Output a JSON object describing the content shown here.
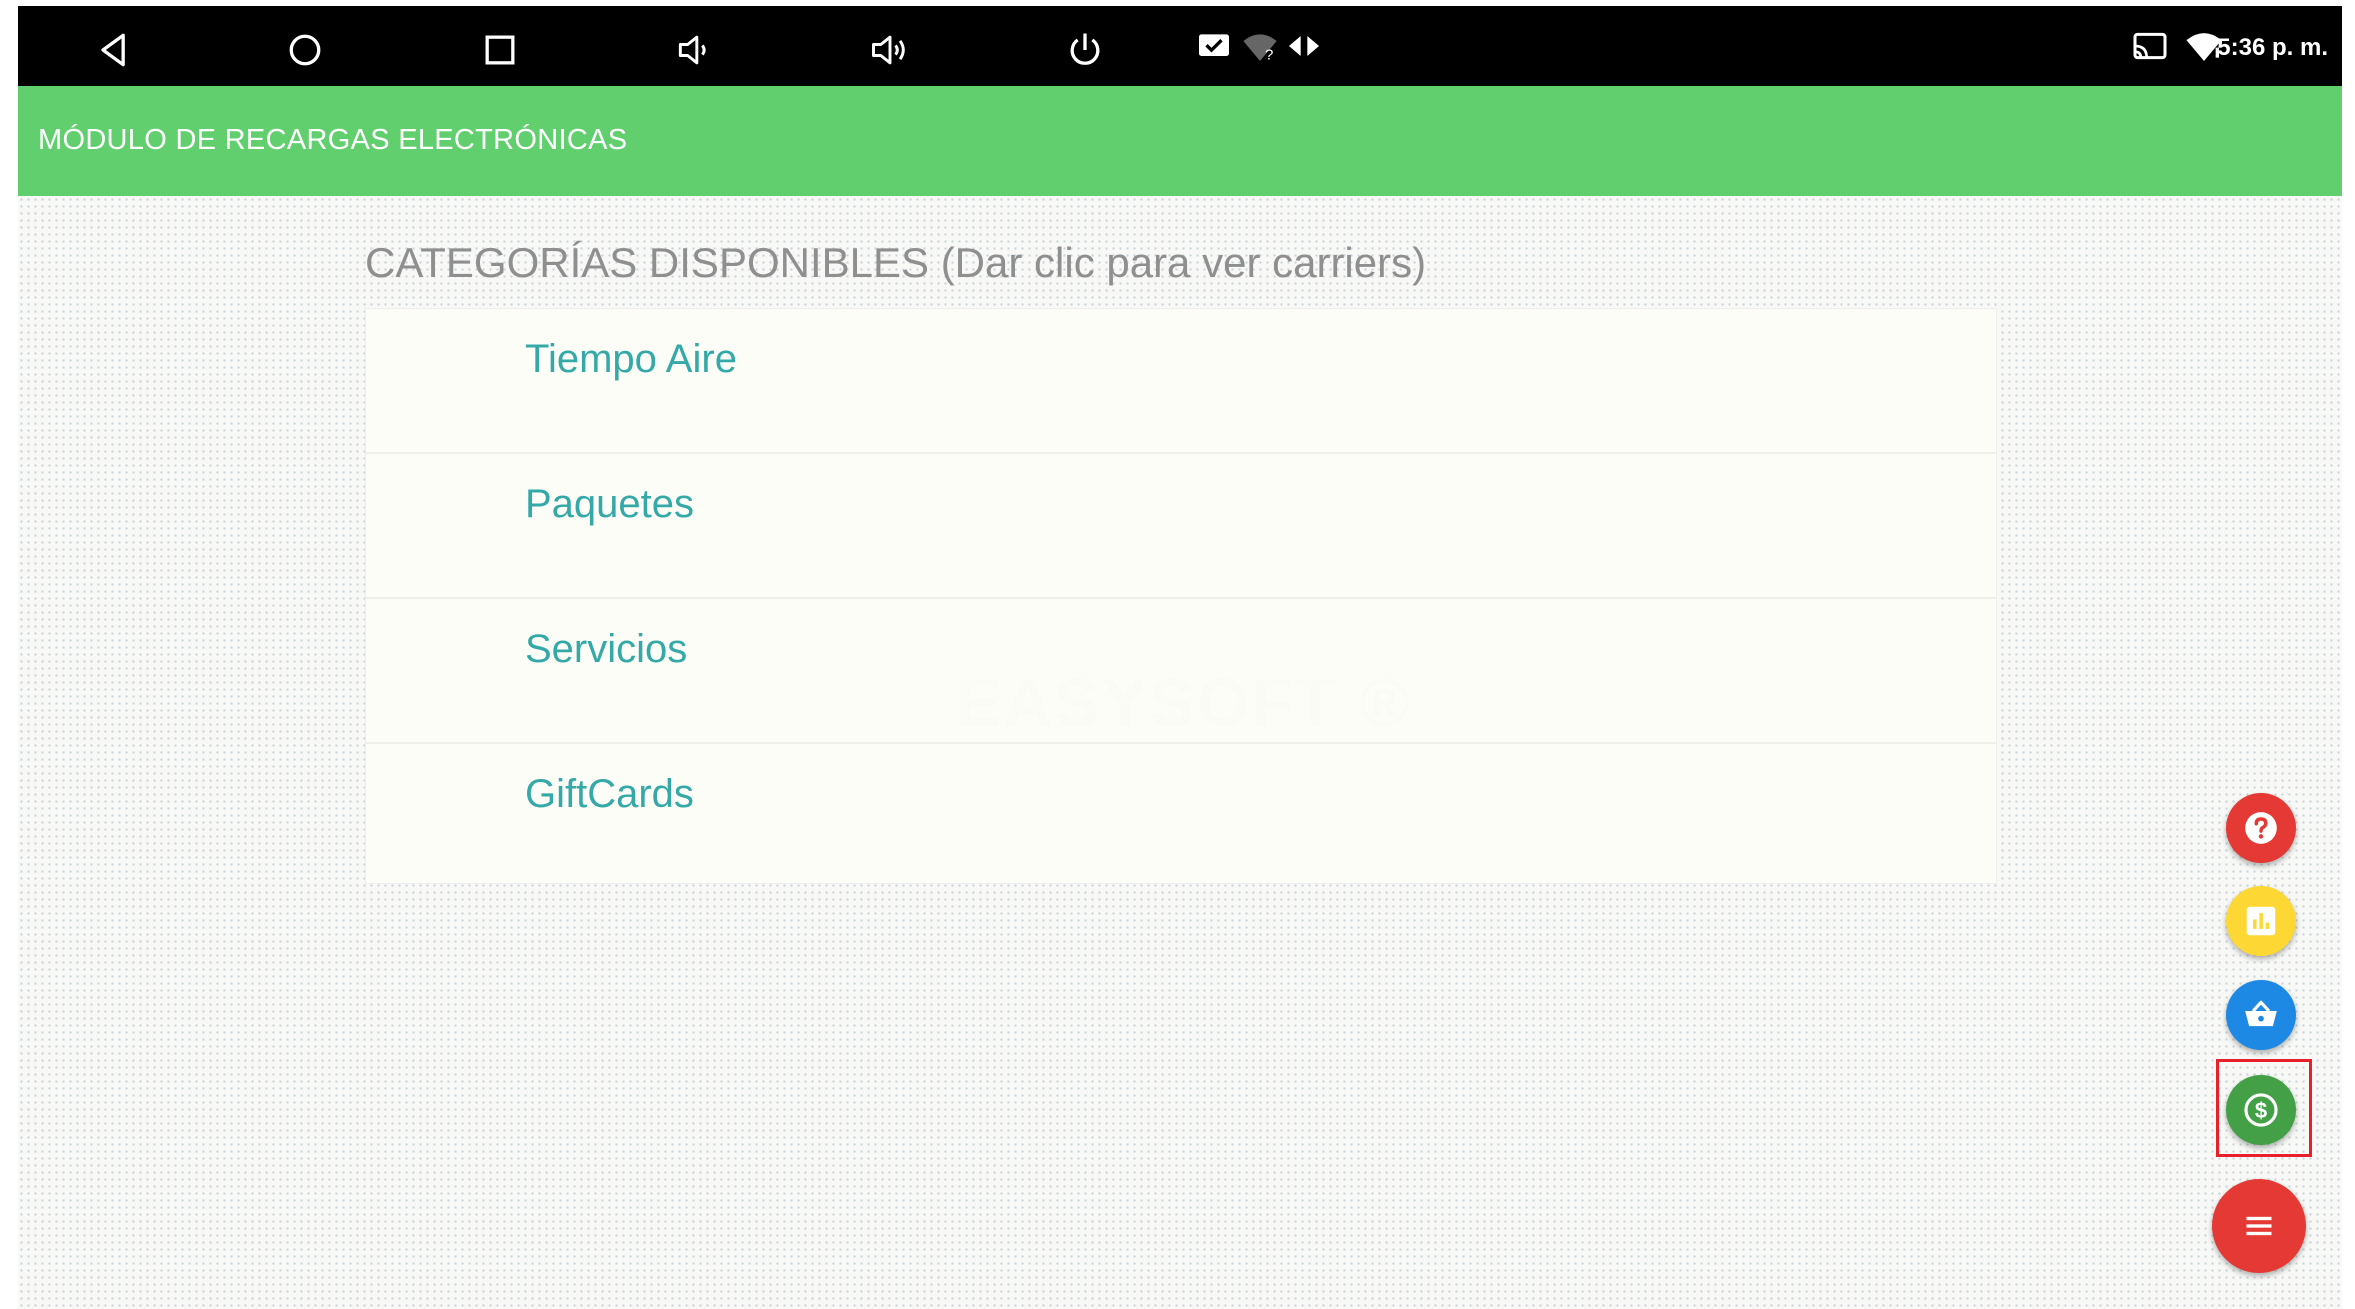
{
  "status_bar": {
    "time": "5:36 p. m.",
    "nav_icons": [
      "back-icon",
      "home-icon",
      "recents-icon",
      "volume-down-icon",
      "volume-up-icon",
      "power-icon"
    ],
    "notification_icons": [
      "check-message-icon",
      "wifi-question-icon",
      "data-sync-icon"
    ],
    "system_icons": [
      "cast-icon",
      "wifi-icon"
    ]
  },
  "app_bar": {
    "title": "MÓDULO DE RECARGAS ELECTRÓNICAS",
    "color": "#62cf6e"
  },
  "main": {
    "section_title": "CATEGORÍAS DISPONIBLES (Dar clic para ver carriers)",
    "watermark": "EASYSOFT ®",
    "categories": [
      {
        "label": "Tiempo Aire"
      },
      {
        "label": "Paquetes"
      },
      {
        "label": "Servicios"
      },
      {
        "label": "GiftCards"
      }
    ]
  },
  "fab_menu": {
    "buttons": [
      {
        "name": "help-button",
        "icon": "question-icon",
        "color": "#e53935"
      },
      {
        "name": "reports-button",
        "icon": "bar-chart-icon",
        "color": "#fdd835"
      },
      {
        "name": "cart-button",
        "icon": "basket-icon",
        "color": "#1e88e5"
      },
      {
        "name": "payment-button",
        "icon": "dollar-icon",
        "color": "#43a047",
        "highlighted": true
      },
      {
        "name": "menu-button",
        "icon": "menu-icon",
        "color": "#e53935"
      }
    ]
  }
}
